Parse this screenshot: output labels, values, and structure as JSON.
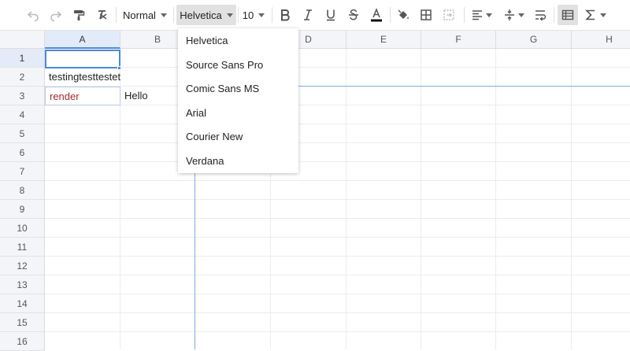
{
  "toolbar": {
    "format_label": "Normal",
    "font_label": "Helvetica",
    "font_size_label": "10"
  },
  "colors": {
    "accent": "#4b89dc",
    "red_text": "#a52a2a",
    "header_bg": "#f4f5f8"
  },
  "columns": [
    "A",
    "B",
    "C",
    "D",
    "E",
    "F",
    "G",
    "H"
  ],
  "rows": [
    "1",
    "2",
    "3",
    "4",
    "5",
    "6",
    "7",
    "8",
    "9",
    "10",
    "11",
    "12",
    "13",
    "14",
    "15",
    "16"
  ],
  "cells": {
    "a2": "testingtesttestetest",
    "a3": "render",
    "b3": "Hello"
  },
  "font_menu": {
    "items": [
      "Helvetica",
      "Source Sans Pro",
      "Comic Sans MS",
      "Arial",
      "Courier New",
      "Verdana"
    ]
  }
}
